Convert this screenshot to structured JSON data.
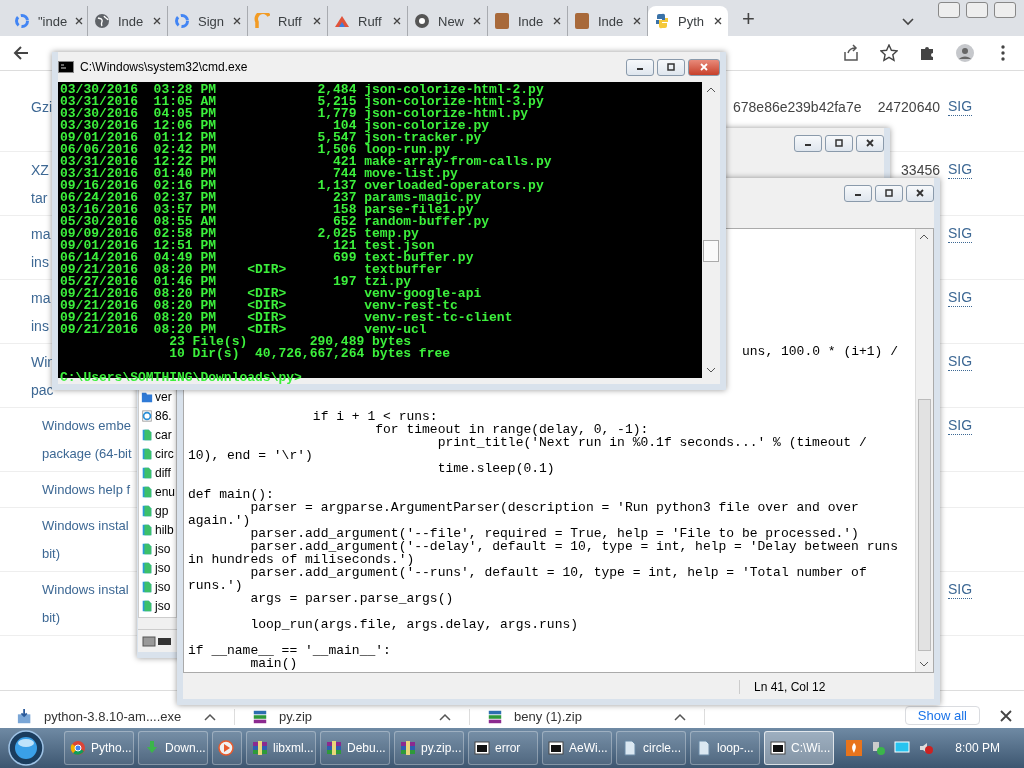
{
  "browser": {
    "tabs": [
      {
        "title": "\"inde",
        "kind": "ring",
        "selected": false
      },
      {
        "title": "Inde",
        "kind": "globe",
        "selected": false
      },
      {
        "title": "Sign",
        "kind": "ring",
        "selected": false
      },
      {
        "title": "Ruff",
        "kind": "arc",
        "selected": false
      },
      {
        "title": "Ruff",
        "kind": "tent",
        "selected": false
      },
      {
        "title": "New",
        "kind": "wheel",
        "selected": false
      },
      {
        "title": "Inde",
        "kind": "avatar",
        "selected": false
      },
      {
        "title": "Inde",
        "kind": "avatar",
        "selected": false
      },
      {
        "title": "Pyth",
        "kind": "logo",
        "selected": true
      }
    ],
    "new_tab": "+",
    "rows": [
      {
        "lines": [
          "Gzi"
        ],
        "hash": "678e86e239b42fa7e",
        "size": "24720640",
        "sig": "SIG"
      },
      {
        "lines": [
          "XZ",
          "tar"
        ],
        "size": "33456",
        "sig": "SIG"
      },
      {
        "lines": [
          "ma",
          "ins"
        ],
        "sig": "SIG"
      },
      {
        "lines": [
          "ma",
          "ins"
        ],
        "sig": "SIG"
      },
      {
        "lines": [
          "Win",
          "pac"
        ],
        "sig": "SIG"
      },
      {
        "lines": [
          "Windows embe",
          "package (64-bit"
        ],
        "sig": "SIG"
      },
      {
        "lines": [
          "Windows help f"
        ]
      },
      {
        "lines": [
          "Windows instal",
          "bit)"
        ]
      },
      {
        "lines": [
          "Windows instal",
          "bit)"
        ],
        "sig": "SIG"
      }
    ]
  },
  "explorer": {
    "files": [
      {
        "name": "ver",
        "kind": "folder"
      },
      {
        "name": "86.",
        "kind": "web"
      },
      {
        "name": "car",
        "kind": "file"
      },
      {
        "name": "circ",
        "kind": "file"
      },
      {
        "name": "diff",
        "kind": "file"
      },
      {
        "name": "enu",
        "kind": "file"
      },
      {
        "name": "gp",
        "kind": "file"
      },
      {
        "name": "hilb",
        "kind": "file"
      },
      {
        "name": "jso",
        "kind": "file"
      },
      {
        "name": "jso",
        "kind": "file"
      },
      {
        "name": "jso",
        "kind": "file"
      },
      {
        "name": "jso",
        "kind": "file"
      }
    ]
  },
  "editor": {
    "blocks": [
      [
        "uns, 100.0 * (i+1) /"
      ],
      [
        "\t\tif i + 1 < runs:",
        "\t\t\tfor timeout in range(delay, 0, -1):",
        "\t\t\t\tprint_title('Next run in %0.1f seconds...' % (timeout /",
        "10), end = '\\r')",
        "\t\t\t\ttime.sleep(0.1)"
      ],
      [
        "def main():",
        "\tparser = argparse.ArgumentParser(description = 'Run python3 file over and over",
        "again.')",
        "\tparser.add_argument('--file', required = True, help = 'File to be processed.')",
        "\tparser.add_argument('--delay', default = 10, type = int, help = 'Delay between runs",
        "in hundreds of miliseconds.')",
        "\tparser.add_argument('--runs', default = 10, type = int, help = 'Total number of",
        "runs.')",
        "\targs = parser.parse_args()"
      ],
      [
        "\tloop_run(args.file, args.delay, args.runs)"
      ],
      [
        "if __name__ == '__main__':",
        "\tmain()"
      ]
    ],
    "status": "Ln 41, Col 12"
  },
  "console": {
    "title": "C:\\Windows\\system32\\cmd.exe",
    "lines": [
      "03/30/2016  03:28 PM             2,484 json-colorize-html-2.py",
      "03/31/2016  11:05 AM             5,215 json-colorize-html-3.py",
      "03/30/2016  04:05 PM             1,779 json-colorize-html.py",
      "03/30/2016  12:06 PM               104 json-colorize.py",
      "09/01/2016  01:12 PM             5,547 json-tracker.py",
      "06/06/2016  02:42 PM             1,506 loop-run.py",
      "03/31/2016  12:22 PM               421 make-array-from-calls.py",
      "03/31/2016  01:40 PM               744 move-list.py",
      "09/16/2016  02:16 PM             1,137 overloaded-operators.py",
      "06/24/2016  02:37 PM               237 params-magic.py",
      "03/16/2016  03:57 PM               158 parse-file1.py",
      "05/30/2016  08:55 AM               652 random-buffer.py",
      "09/09/2016  02:58 PM             2,025 temp.py",
      "09/01/2016  12:51 PM               121 test.json",
      "06/14/2016  04:49 PM               699 text-buffer.py",
      "09/21/2016  08:20 PM    <DIR>          textbuffer",
      "05/27/2016  01:46 PM               197 tzi.py",
      "09/21/2016  08:20 PM    <DIR>          venv-google-api",
      "09/21/2016  08:20 PM    <DIR>          venv-rest-tc",
      "09/21/2016  08:20 PM    <DIR>          venv-rest-tc-client",
      "09/21/2016  08:20 PM    <DIR>          venv-ucl",
      "              23 File(s)        290,489 bytes",
      "              10 Dir(s)  40,726,667,264 bytes free"
    ],
    "prompt": "C:\\Users\\SOMTHING\\Downloads\\py>"
  },
  "downloads": {
    "items": [
      {
        "name": "python-3.8.10-am....exe",
        "kind": "installer"
      },
      {
        "name": "py.zip",
        "kind": "archive"
      },
      {
        "name": "beny (1).zip",
        "kind": "archive"
      }
    ],
    "show_all": "Show all"
  },
  "taskbar": {
    "items": [
      {
        "label": "Pytho...",
        "kind": "wheel",
        "selected": false
      },
      {
        "label": "Down...",
        "kind": "download",
        "selected": false
      },
      {
        "kind": "play",
        "selected": false
      },
      {
        "label": "libxml...",
        "kind": "archive",
        "selected": false
      },
      {
        "label": "Debu...",
        "kind": "archive",
        "selected": false
      },
      {
        "label": "py.zip...",
        "kind": "archive",
        "selected": false
      },
      {
        "label": "error",
        "kind": "console",
        "selected": false
      },
      {
        "label": "AeWi...",
        "kind": "console",
        "selected": false
      },
      {
        "label": "circle...",
        "kind": "page",
        "selected": false
      },
      {
        "label": "loop-...",
        "kind": "page",
        "selected": false
      },
      {
        "label": "C:\\Wi...",
        "kind": "console",
        "selected": true
      }
    ],
    "clock": "8:00 PM"
  }
}
